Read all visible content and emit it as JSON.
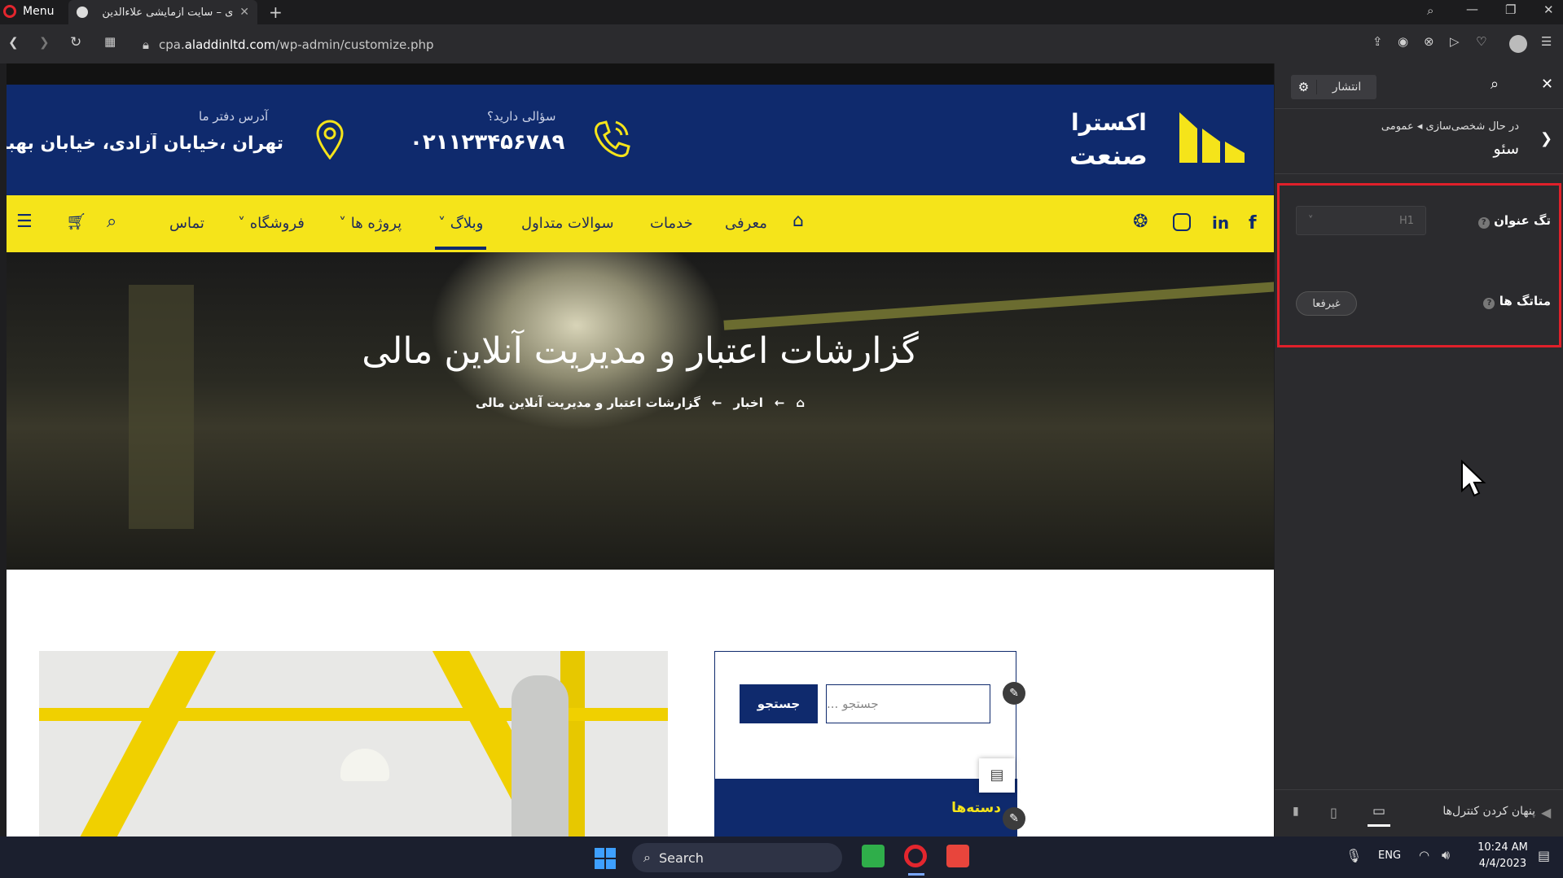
{
  "browser": {
    "menu_label": "Menu",
    "tab_title": "ی – سایت آزمایشی علاءالدین",
    "url_prefix": "cpa.",
    "url_domain": "aladdinltd.com",
    "url_path": "/wp-admin/customize.php"
  },
  "site": {
    "logo_line1": "اکسترا",
    "logo_line2": "صنعت",
    "contact_question": "سؤالی دارید؟",
    "contact_phone": "۰۲۱۱۲۳۴۵۶۷۸۹",
    "address_label": "آدرس دفتر ما",
    "address_value": "تهران ،خیابان آزادی، خیابان بهبو",
    "nav": [
      "معرفی",
      "خدمات",
      "سوالات متداول",
      "وبلاگ",
      "پروژه ها",
      "فروشگاه",
      "تماس"
    ],
    "hero_title": "گزارشات اعتبار و مدیریت آنلاین مالی",
    "breadcrumb": [
      "اخبار",
      "گزارشات اعتبار و مدیریت آنلاین مالی"
    ],
    "search_placeholder": "جستجو ...",
    "search_button": "جستجو",
    "categories_title": "دسته‌ها"
  },
  "panel": {
    "publish_label": "انتشار",
    "breadcrumb_lead": "در حال شخصی‌سازی",
    "breadcrumb_section": "عمومی",
    "section_title": "سئو",
    "heading_tag_label": "تگ عنوان",
    "heading_tag_value": "H1",
    "meta_tags_label": "متاتگ ها",
    "meta_tags_toggle": "غیرفعا",
    "hide_controls": "پنهان کردن کنترل‌ها"
  },
  "taskbar": {
    "search_label": "Search",
    "lang": "ENG",
    "time": "10:24 AM",
    "date": "4/4/2023"
  },
  "colors": {
    "navy": "#0f2a6d",
    "yellow": "#f5e41a",
    "highlight": "#e0202a"
  }
}
